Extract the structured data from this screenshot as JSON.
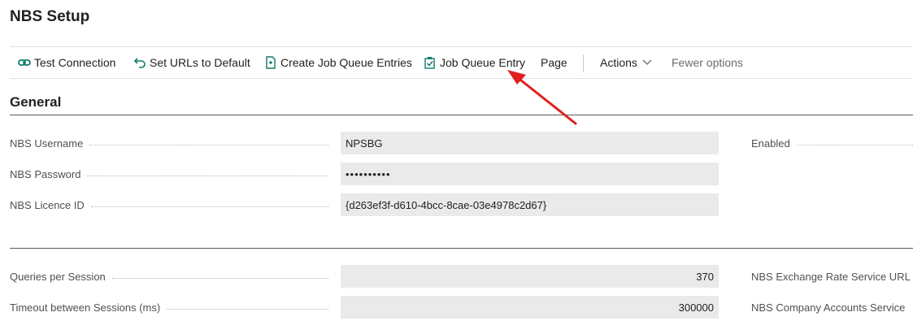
{
  "page": {
    "title": "NBS Setup"
  },
  "toolbar": {
    "test_connection": "Test Connection",
    "set_urls": "Set URLs to Default",
    "create_jobs": "Create Job Queue Entries",
    "job_queue_entry": "Job Queue Entry",
    "page": "Page",
    "actions": "Actions",
    "fewer_options": "Fewer options"
  },
  "general": {
    "title": "General",
    "username_label": "NBS Username",
    "username_value": "NPSBG",
    "password_label": "NBS Password",
    "password_value": "••••••••••",
    "licence_label": "NBS Licence ID",
    "licence_value": "{d263ef3f-d610-4bcc-8cae-03e4978c2d67}",
    "enabled_label": "Enabled"
  },
  "session": {
    "queries_label": "Queries per Session",
    "queries_value": "370",
    "timeout_label": "Timeout between Sessions (ms)",
    "timeout_value": "300000",
    "exchange_url_label": "NBS Exchange Rate Service URL",
    "company_accounts_label": "NBS Company Accounts Service"
  },
  "colors": {
    "accent": "#0f7b6c",
    "arrow": "#e02020"
  }
}
